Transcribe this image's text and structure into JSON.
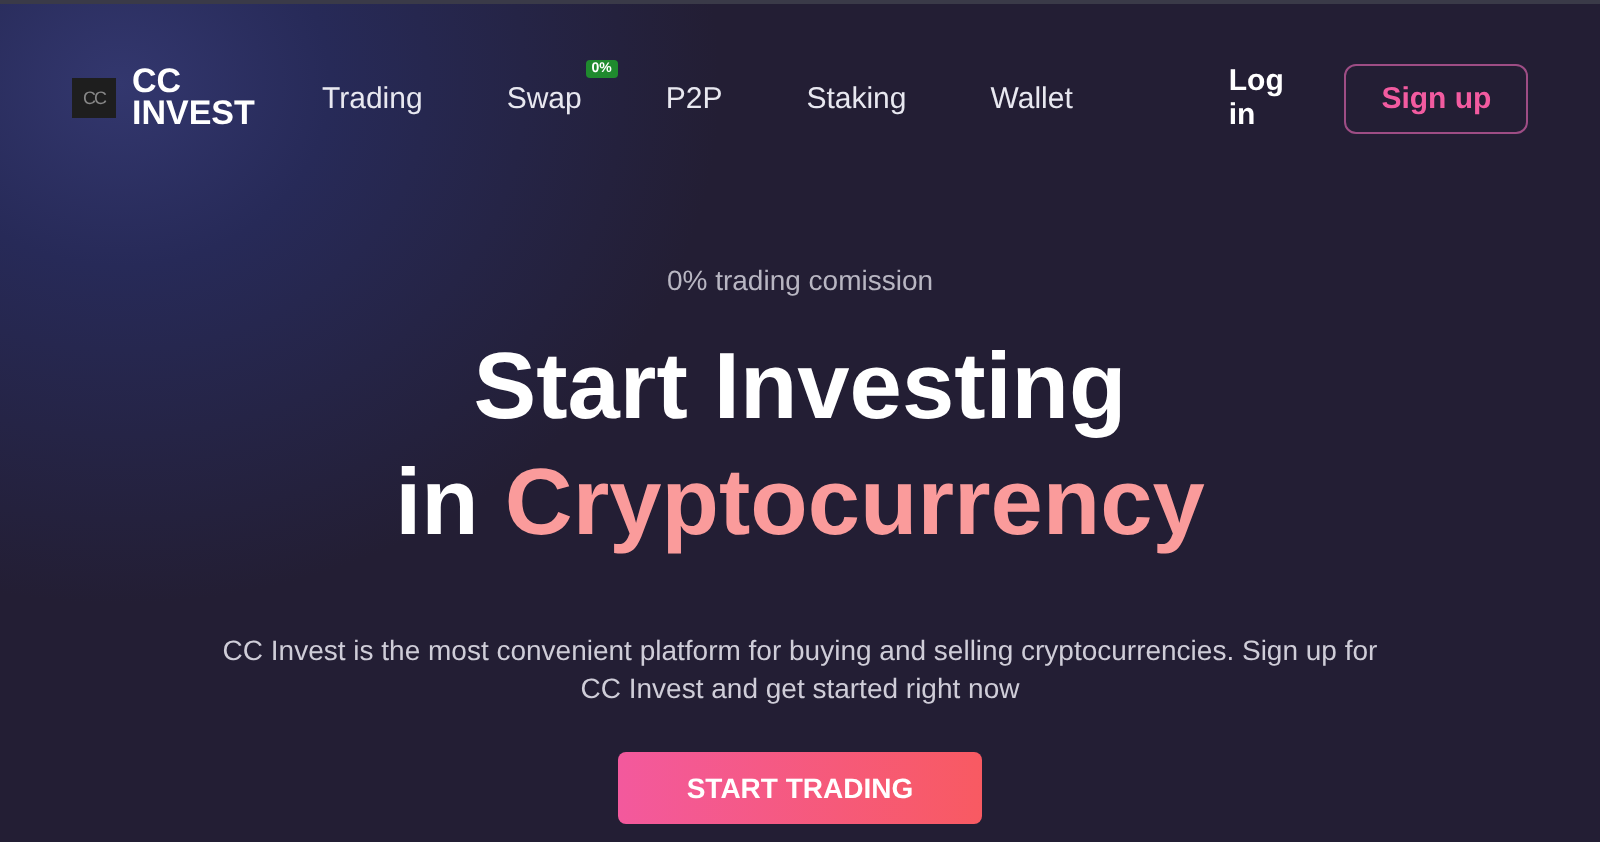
{
  "header": {
    "logo": {
      "mark": "CC",
      "name_lines": [
        "CC",
        "INVEST"
      ]
    },
    "nav": [
      {
        "label": "Trading"
      },
      {
        "label": "Swap",
        "badge": "0%"
      },
      {
        "label": "P2P"
      },
      {
        "label": "Staking"
      },
      {
        "label": "Wallet"
      }
    ],
    "login": "Log in",
    "signup": "Sign up"
  },
  "hero": {
    "eyebrow": "0% trading comission",
    "title_line_1": "Start Investing",
    "title_line_2_prefix": "in",
    "title_line_2_highlight": "Cryptocurrency",
    "description": "CC Invest is the most convenient platform for buying and selling cryptocurrencies. Sign up for CC Invest and get started right now",
    "cta": "START TRADING"
  }
}
